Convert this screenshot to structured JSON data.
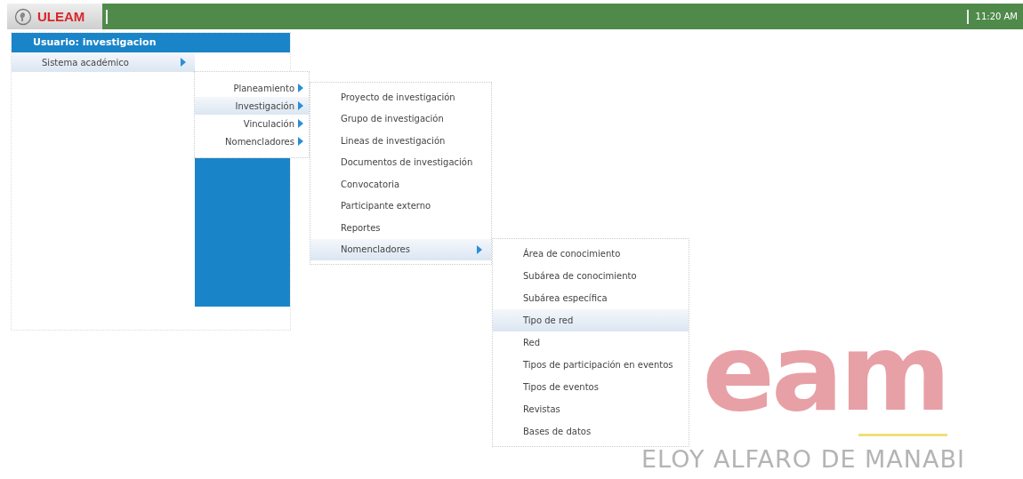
{
  "taskbar": {
    "start_label": "ULEAM",
    "clock": "11:20 AM"
  },
  "start_menu": {
    "user": "Usuario: investigacion",
    "items": [
      {
        "label": "Sistema académico",
        "selected": true,
        "children": [
          {
            "label": "Planeamiento",
            "selected": false,
            "has_submenu": true
          },
          {
            "label": "Investigación",
            "selected": true,
            "children": [
              {
                "label": "Proyecto de investigación",
                "selected": false
              },
              {
                "label": "Grupo de investigación",
                "selected": false
              },
              {
                "label": "Lineas de investigación",
                "selected": false
              },
              {
                "label": "Documentos de investigación",
                "selected": false
              },
              {
                "label": "Convocatoria",
                "selected": false
              },
              {
                "label": "Participante externo",
                "selected": false
              },
              {
                "label": "Reportes",
                "selected": false
              },
              {
                "label": "Nomencladores",
                "selected": true,
                "children": [
                  {
                    "label": "Área de conocimiento",
                    "selected": false
                  },
                  {
                    "label": "Subárea de conocimiento",
                    "selected": false
                  },
                  {
                    "label": "Subárea específica",
                    "selected": false
                  },
                  {
                    "label": "Tipo de red",
                    "selected": true
                  },
                  {
                    "label": "Red",
                    "selected": false
                  },
                  {
                    "label": "Tipos de participación en eventos",
                    "selected": false
                  },
                  {
                    "label": "Tipos de eventos",
                    "selected": false
                  },
                  {
                    "label": "Revistas",
                    "selected": false
                  },
                  {
                    "label": "Bases de datos",
                    "selected": false
                  }
                ]
              }
            ]
          },
          {
            "label": "Vinculación",
            "selected": false,
            "has_submenu": true
          },
          {
            "label": "Nomencladores",
            "selected": false,
            "has_submenu": true
          }
        ]
      }
    ]
  },
  "background_logo": {
    "text": "eam",
    "subtitle": "ELOY ALFARO DE MANABI"
  }
}
